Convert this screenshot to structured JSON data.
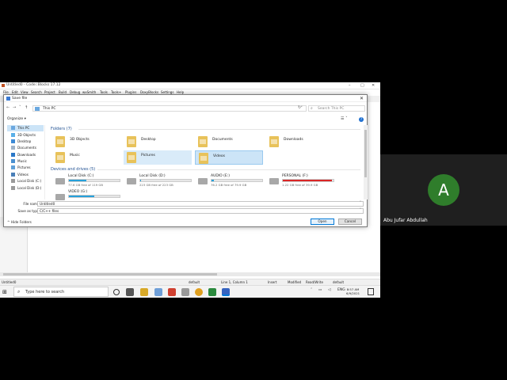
{
  "meeting": {
    "avatar_initial": "A",
    "participant_name": "Abu Jufar Abdullah"
  },
  "codeblocks": {
    "title": "Untitled0 - Code::Blocks 17.12",
    "menu": [
      "File",
      "Edit",
      "View",
      "Search",
      "Project",
      "Build",
      "Debug",
      "wxSmith",
      "Tools",
      "Tools+",
      "Plugins",
      "DoxyBlocks",
      "Settings",
      "Help"
    ],
    "status": {
      "file": "Untitled0",
      "encoding": "default",
      "position": "Line 1, Column 1",
      "insert": "Insert",
      "modified": "Modified",
      "rw": "Read/Write",
      "lang": "default"
    }
  },
  "dialog": {
    "title": "Save file",
    "address": "This PC",
    "search_placeholder": "Search This PC",
    "organize": "Organize ▾",
    "nav_items": [
      "This PC",
      "3D Objects",
      "Desktop",
      "Documents",
      "Downloads",
      "Music",
      "Pictures",
      "Videos",
      "Local Disk (C:)",
      "Local Disk (D:)"
    ],
    "folders_header": "Folders (7)",
    "folders": [
      "3D Objects",
      "Desktop",
      "Documents",
      "Downloads",
      "Music",
      "Pictures",
      "Videos"
    ],
    "drives_header": "Devices and drives (5)",
    "drives": [
      {
        "name": "Local Disk (C:)",
        "free": "77.6 GB free of 119 GB",
        "used_fraction": 0.35,
        "color": "#26a0da"
      },
      {
        "name": "Local Disk (D:)",
        "free": "223 GB free of 223 GB",
        "used_fraction": 0.01,
        "color": "#26a0da"
      },
      {
        "name": "AUDIO (E:)",
        "free": "76.2 GB free of 79.9 GB",
        "used_fraction": 0.05,
        "color": "#26a0da"
      },
      {
        "name": "PERSONAL (F:)",
        "free": "1.22 GB free of 39.9 GB",
        "used_fraction": 0.97,
        "color": "#da2626"
      },
      {
        "name": "VIDEO (G:)",
        "free": "",
        "used_fraction": 0.5,
        "color": "#26a0da"
      }
    ],
    "filename_label": "File name:",
    "filename_value": "Untitled0",
    "savetype_label": "Save as type:",
    "savetype_value": "C/C++ files",
    "hide_folders": "^ Hide Folders",
    "open_label": "Open",
    "cancel_label": "Cancel"
  },
  "taskbar": {
    "search_text": "Type here to search",
    "tray_lang": "ENG",
    "time": "8:57 AM",
    "date": "6/9/2021"
  }
}
